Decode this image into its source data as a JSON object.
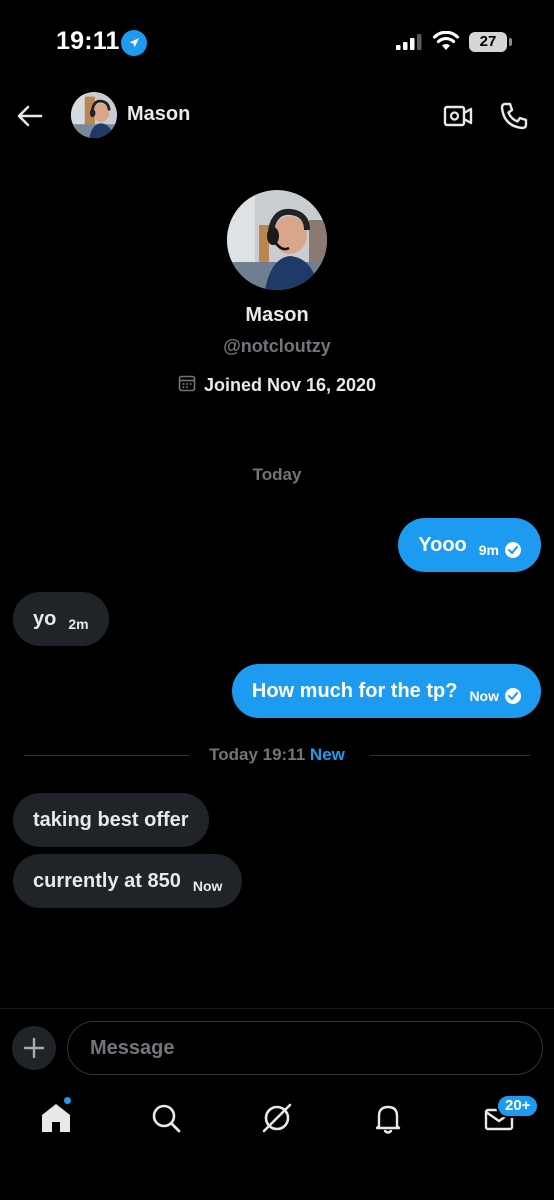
{
  "status_bar": {
    "time": "19:11",
    "battery": "27"
  },
  "header": {
    "name": "Mason",
    "icons": [
      "back-arrow-icon",
      "video-icon",
      "phone-icon"
    ]
  },
  "profile": {
    "name": "Mason",
    "handle": "@notcloutzy",
    "joined": "Joined Nov 16, 2020"
  },
  "conversation": {
    "day_label": "Today",
    "messages": [
      {
        "direction": "out",
        "text": "Yooo",
        "meta": "9m"
      },
      {
        "direction": "in",
        "text": "yo",
        "meta": "2m"
      },
      {
        "direction": "out",
        "text": "How much for the tp?",
        "meta": "Now"
      },
      {
        "direction": "in",
        "text": "taking best offer",
        "meta": ""
      },
      {
        "direction": "in",
        "text": "currently at 850",
        "meta": "Now"
      }
    ],
    "divider": {
      "time": "Today 19:11",
      "new_label": "New"
    }
  },
  "composer": {
    "placeholder": "Message"
  },
  "tabbar": {
    "badge": "20+"
  },
  "colors": {
    "accent": "#1d9bf0",
    "incoming_bubble": "#202327",
    "muted": "#71767b",
    "background": "#000000"
  }
}
